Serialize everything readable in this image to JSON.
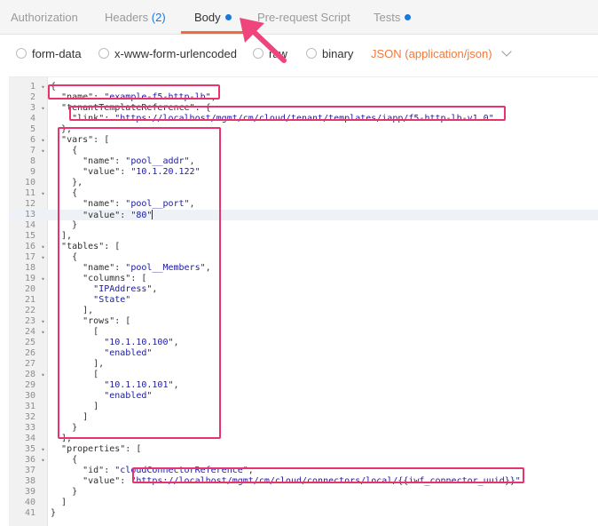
{
  "tabs": [
    {
      "label": "Authorization"
    },
    {
      "label": "Headers",
      "count": "(2)"
    },
    {
      "label": "Body",
      "dot": true
    },
    {
      "label": "Pre-request Script"
    },
    {
      "label": "Tests",
      "dot": true
    }
  ],
  "modes": {
    "form_data": "form-data",
    "urlencoded": "x-www-form-urlencoded",
    "raw": "raw",
    "binary": "binary",
    "json_type": "JSON (application/json)"
  },
  "icons": {
    "radio": "radio-icon",
    "chevron": "chevron-down-icon",
    "arrow": "pointer-arrow-icon"
  },
  "colors": {
    "accent": "#f26b3a",
    "link": "#1a78d6",
    "highlight": "#e8336d"
  },
  "editor": {
    "active_line": 13,
    "lines": [
      {
        "n": "1",
        "fold": "▾",
        "text": "{"
      },
      {
        "n": "2",
        "text": "  \"name\": \"example-f5-http-lb\","
      },
      {
        "n": "3",
        "fold": "▾",
        "text": "  \"tenantTemplateReference\": {"
      },
      {
        "n": "4",
        "text": "    \"link\": \"https://localhost/mgmt/cm/cloud/tenant/templates/iapp/f5-http-lb-v1.0\""
      },
      {
        "n": "5",
        "text": "  },"
      },
      {
        "n": "6",
        "fold": "▾",
        "text": "  \"vars\": ["
      },
      {
        "n": "7",
        "fold": "▾",
        "text": "    {"
      },
      {
        "n": "8",
        "text": "      \"name\": \"pool__addr\","
      },
      {
        "n": "9",
        "text": "      \"value\": \"10.1.20.122\""
      },
      {
        "n": "10",
        "text": "    },"
      },
      {
        "n": "11",
        "fold": "▾",
        "text": "    {"
      },
      {
        "n": "12",
        "text": "      \"name\": \"pool__port\","
      },
      {
        "n": "13",
        "text": "      \"value\": \"80\""
      },
      {
        "n": "14",
        "text": "    }"
      },
      {
        "n": "15",
        "text": "  ],"
      },
      {
        "n": "16",
        "fold": "▾",
        "text": "  \"tables\": ["
      },
      {
        "n": "17",
        "fold": "▾",
        "text": "    {"
      },
      {
        "n": "18",
        "text": "      \"name\": \"pool__Members\","
      },
      {
        "n": "19",
        "fold": "▾",
        "text": "      \"columns\": ["
      },
      {
        "n": "20",
        "text": "        \"IPAddress\","
      },
      {
        "n": "21",
        "text": "        \"State\""
      },
      {
        "n": "22",
        "text": "      ],"
      },
      {
        "n": "23",
        "fold": "▾",
        "text": "      \"rows\": ["
      },
      {
        "n": "24",
        "fold": "▾",
        "text": "        ["
      },
      {
        "n": "25",
        "text": "          \"10.1.10.100\","
      },
      {
        "n": "26",
        "text": "          \"enabled\""
      },
      {
        "n": "27",
        "text": "        ],"
      },
      {
        "n": "28",
        "fold": "▾",
        "text": "        ["
      },
      {
        "n": "29",
        "text": "          \"10.1.10.101\","
      },
      {
        "n": "30",
        "text": "          \"enabled\""
      },
      {
        "n": "31",
        "text": "        ]"
      },
      {
        "n": "32",
        "text": "      ]"
      },
      {
        "n": "33",
        "text": "    }"
      },
      {
        "n": "34",
        "text": "  ],"
      },
      {
        "n": "35",
        "fold": "▾",
        "text": "  \"properties\": ["
      },
      {
        "n": "36",
        "fold": "▾",
        "text": "    {"
      },
      {
        "n": "37",
        "text": "      \"id\": \"cloudConnectorReference\","
      },
      {
        "n": "38",
        "text": "      \"value\": \"https://localhost/mgmt/cm/cloud/connectors/local/{{iwf_connector_uuid}}\""
      },
      {
        "n": "39",
        "text": "    }"
      },
      {
        "n": "40",
        "text": "  ]"
      },
      {
        "n": "41",
        "text": "}"
      }
    ]
  }
}
